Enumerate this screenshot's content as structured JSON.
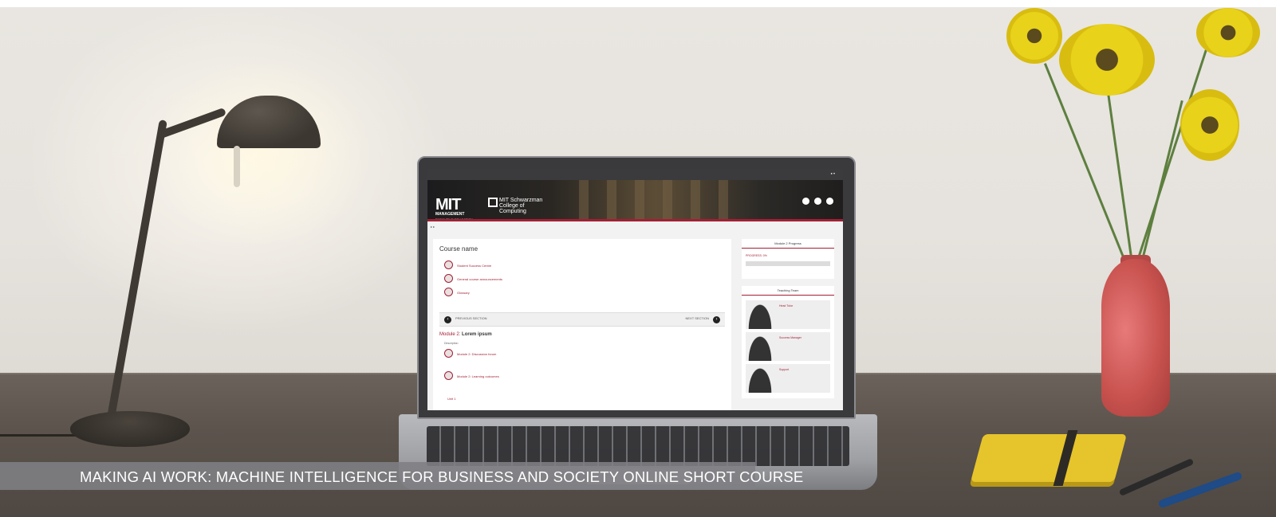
{
  "caption": {
    "title": "MAKING AI WORK: MACHINE INTELLIGENCE FOR BUSINESS AND SOCIETY ONLINE SHORT COURSE"
  },
  "laptop_screen": {
    "logo_mit": "MIT",
    "logo_management": "MANAGEMENT",
    "logo_executive": "EXECUTIVE EDUCATION",
    "logo_schwarzman": "MIT Schwarzman College of Computing",
    "course_name": "Course name",
    "links": [
      "Student Success Centre",
      "General course announcements",
      "Glossary"
    ],
    "prev_section": "PREVIOUS SECTION",
    "next_section": "NEXT SECTION",
    "module_prefix": "Module 2:",
    "module_title": "Lorem ipsum",
    "description": "Description",
    "forum_link": "Module 2: Discussion forum",
    "outcomes_link": "Module 2: Learning outcomes",
    "unit_label": "Unit 1",
    "progress_title": "Module 2 Progress",
    "progress_label": "PROGRESS:",
    "progress_value": "0%",
    "team_title": "Teaching Team",
    "team": [
      "Head Tutor",
      "Success Manager",
      "Support"
    ]
  },
  "colors": {
    "accent": "#a31f34",
    "caption_bg": "#808084"
  }
}
